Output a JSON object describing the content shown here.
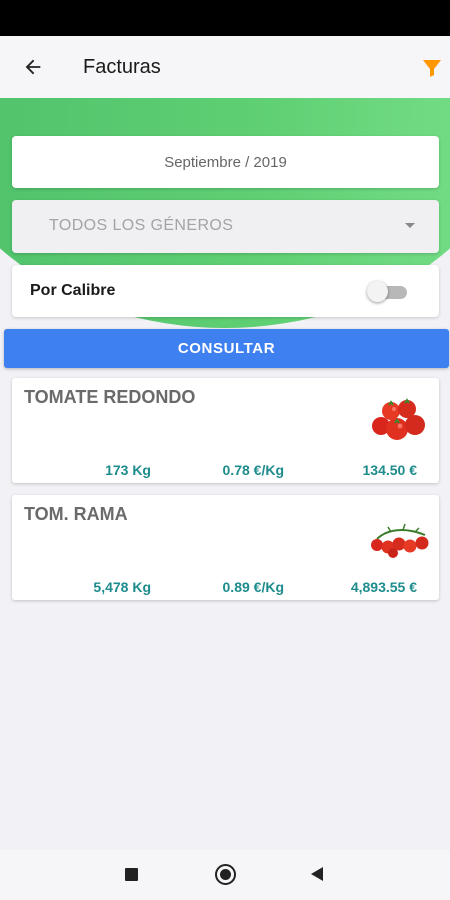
{
  "app_bar": {
    "title": "Facturas",
    "back_icon": "arrow-left-icon",
    "filter_icon": "filter-icon",
    "filter_color": "#ff9800"
  },
  "form": {
    "date_value": "Septiembre / 2019",
    "genre_select": "TODOS LOS GÉNEROS",
    "by_caliber_label": "Por Calibre",
    "by_caliber_on": false,
    "consult_label": "CONSULTAR"
  },
  "colors": {
    "accent_green": "#5fcf73",
    "button_blue": "#3f80f0",
    "metric_teal": "#1e8c8c"
  },
  "products": [
    {
      "name": "TOMATE REDONDO",
      "quantity": "173 Kg",
      "price": "0.78 €/Kg",
      "total": "134.50 €",
      "icon": "tomato-round-icon"
    },
    {
      "name": "TOM. RAMA",
      "quantity": "5,478 Kg",
      "price": "0.89 €/Kg",
      "total": "4,893.55 €",
      "icon": "tomato-vine-icon"
    }
  ],
  "nav": {
    "recents_icon": "square-icon",
    "home_icon": "circle-icon",
    "back_icon": "triangle-back-icon"
  }
}
